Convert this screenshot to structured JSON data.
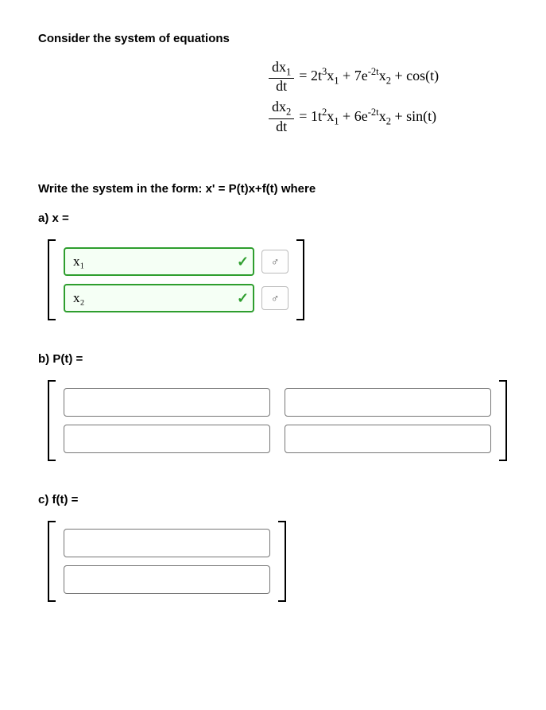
{
  "prompt": "Consider the system of equations",
  "equations": {
    "row1": {
      "dnum": "dx",
      "dsub": "1",
      "dden": "dt",
      "rhs_a": "= 2t",
      "rhs_a_sup": "3",
      "rhs_b": "x",
      "rhs_b_sub": "1",
      "rhs_c": " + 7e",
      "rhs_c_sup": "-2t",
      "rhs_d": "x",
      "rhs_d_sub": "2",
      "rhs_e": " + cos(t)"
    },
    "row2": {
      "dnum": "dx",
      "dsub": "2",
      "dden": "dt",
      "rhs_a": "= 1t",
      "rhs_a_sup": "2",
      "rhs_b": "x",
      "rhs_b_sub": "1",
      "rhs_c": " + 6e",
      "rhs_c_sup": "-2t",
      "rhs_d": "x",
      "rhs_d_sub": "2",
      "rhs_e": " + sin(t)"
    }
  },
  "instruction": "Write the system in the form: x' = P(t)x+f(t) where",
  "parts": {
    "a_label": "a) x =",
    "b_label": "b) P(t) =",
    "c_label": "c) f(t) ="
  },
  "answers": {
    "a": [
      "x_1",
      "x_2"
    ],
    "b": [
      "",
      "",
      "",
      ""
    ],
    "c": [
      "",
      ""
    ]
  },
  "status": {
    "a": [
      "correct",
      "correct"
    ]
  },
  "preview_icon": "♂",
  "check_mark": "✓"
}
